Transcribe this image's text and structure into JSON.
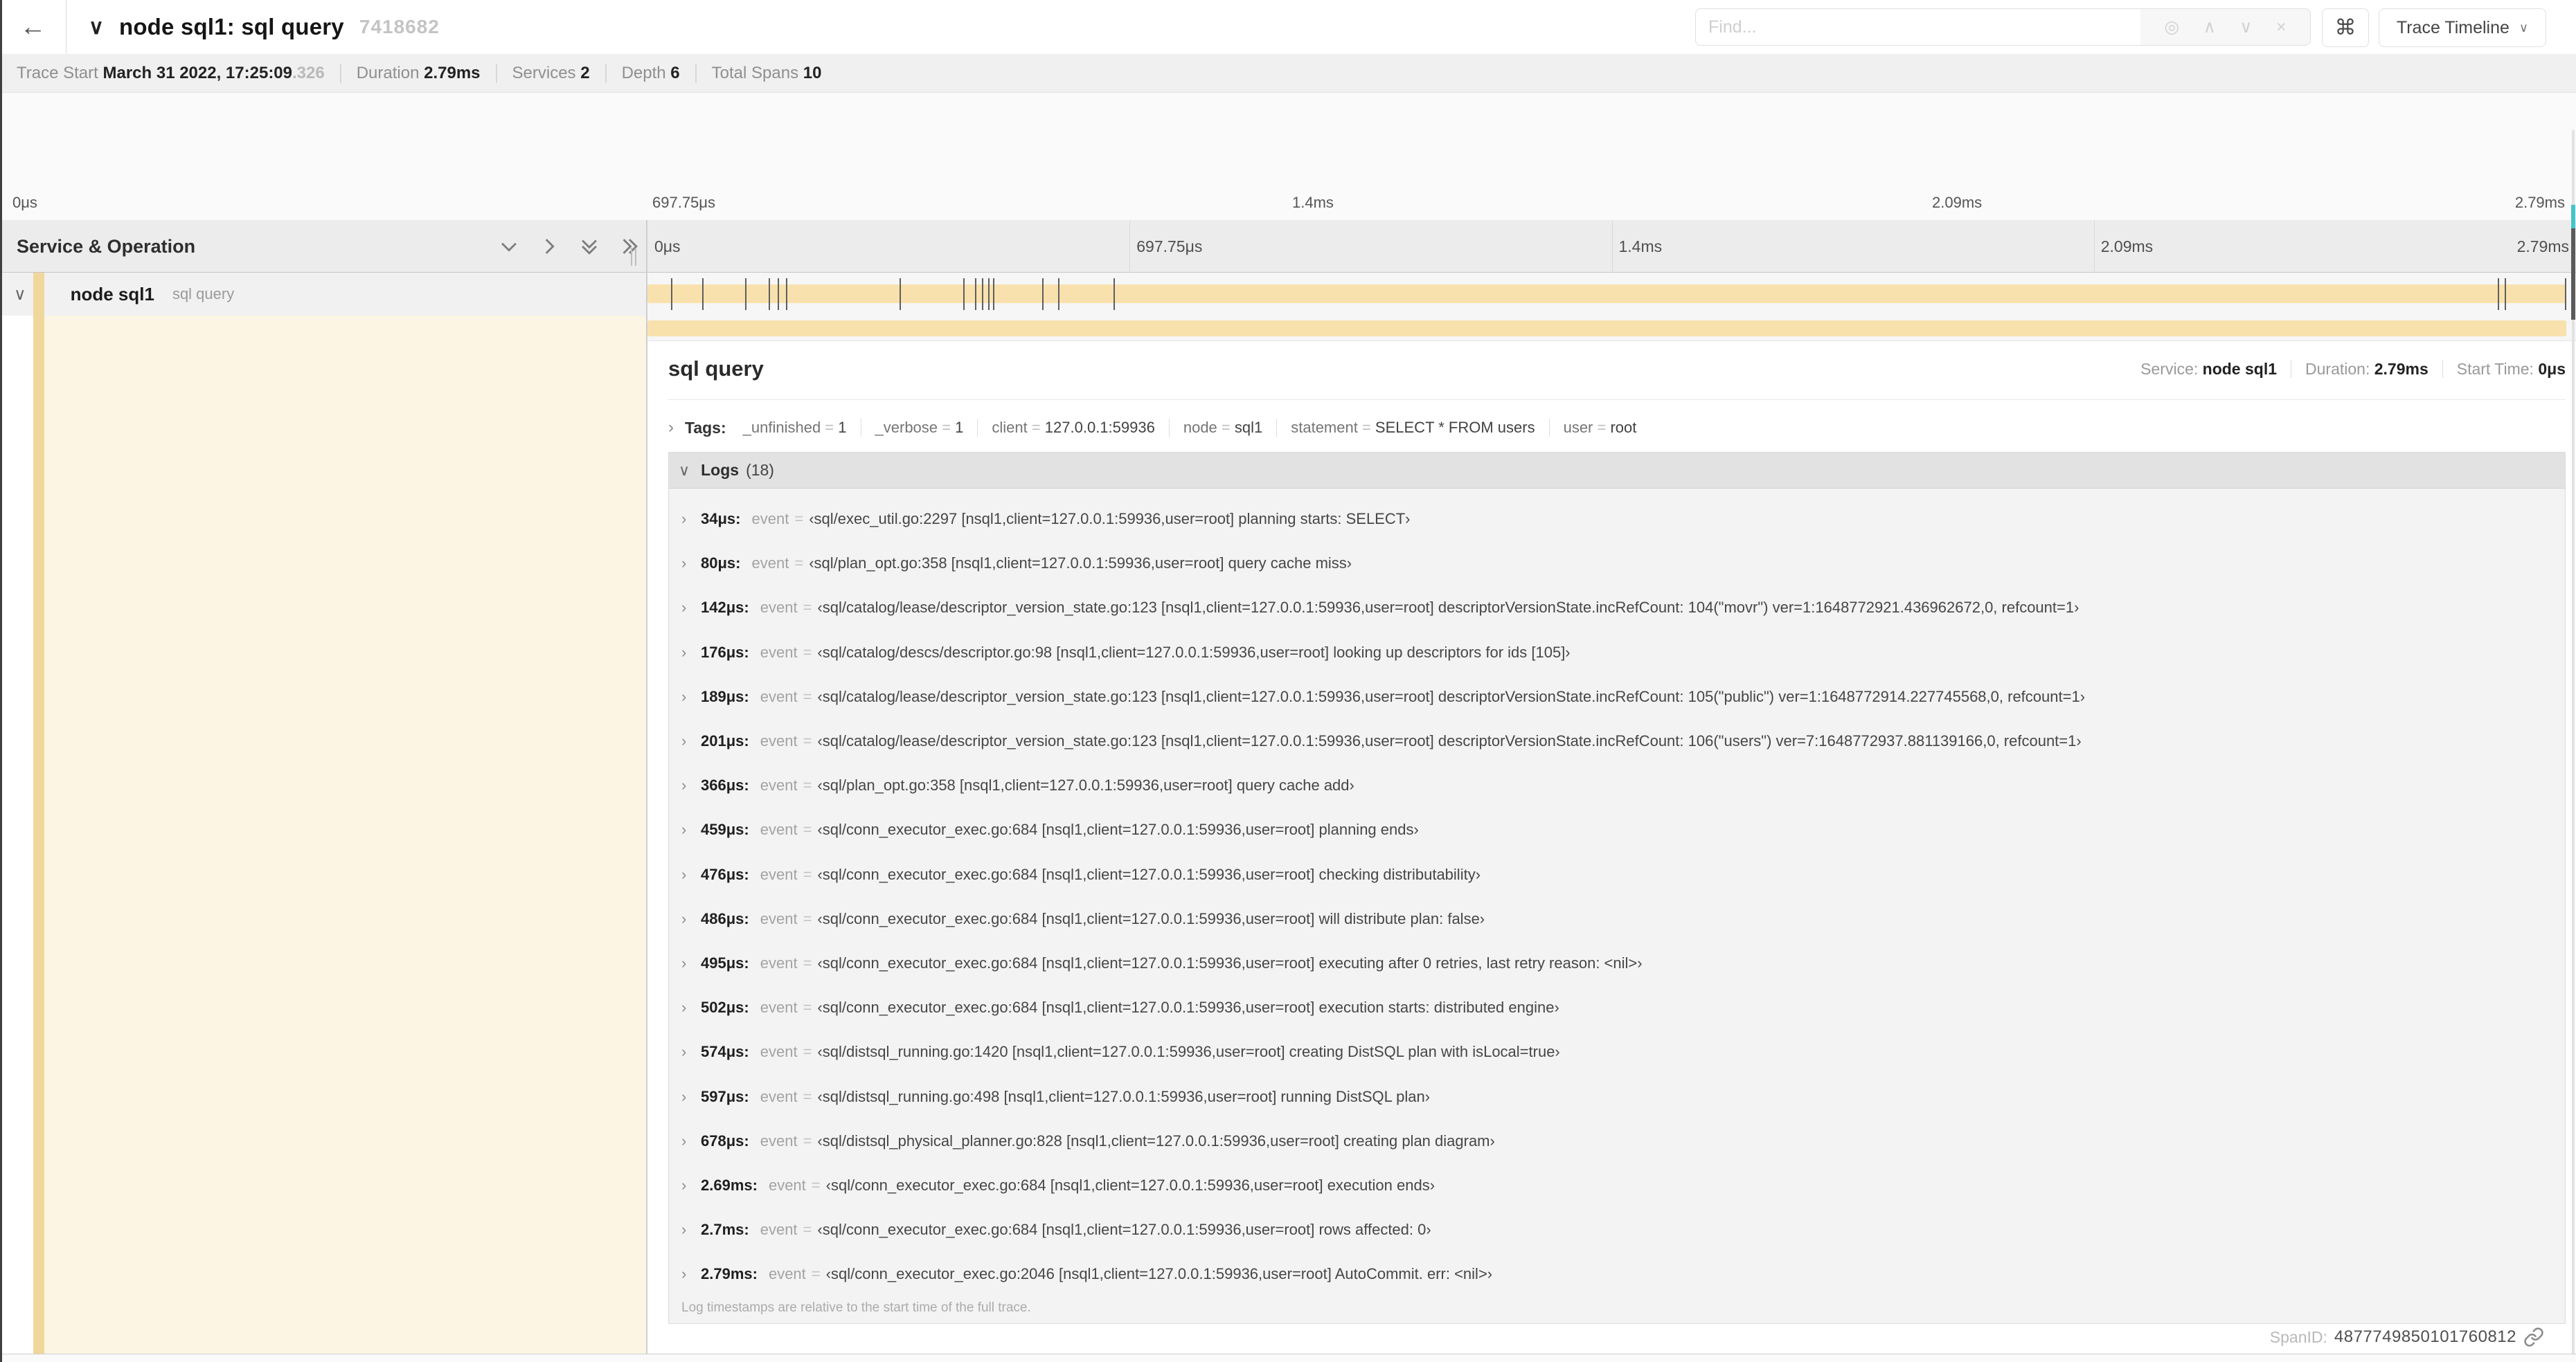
{
  "header": {
    "back_icon": "←",
    "title_chevron": "∨",
    "title": "node sql1: sql query",
    "trace_id": "7418682",
    "find_placeholder": "Find...",
    "locate_icon": "◎",
    "prev_icon": "∧",
    "next_icon": "∨",
    "clear_icon": "×",
    "cmd_icon": "⌘",
    "view_selector": "Trace Timeline",
    "view_chevron": "∨"
  },
  "trace_info": {
    "items": [
      {
        "label": "Trace Start ",
        "value": "March 31 2022, 17:25:09",
        "suffix": ".326"
      },
      {
        "label": "Duration ",
        "value": "2.79ms",
        "suffix": ""
      },
      {
        "label": "Services ",
        "value": "2",
        "suffix": ""
      },
      {
        "label": "Depth ",
        "value": "6",
        "suffix": ""
      },
      {
        "label": "Total Spans ",
        "value": "10",
        "suffix": ""
      }
    ]
  },
  "colors": {
    "tan": "#f8e1ac",
    "teal": "#45c5c9",
    "accent_strip": "#f0d79b",
    "detail_left_bg": "#fcf5e3"
  },
  "ticks": [
    "0μs",
    "697.75μs",
    "1.4ms",
    "2.09ms",
    "2.79ms"
  ],
  "minimap": {
    "rows": [
      {
        "start": 0.0,
        "end": 1.0,
        "color": "tan"
      },
      {
        "start": 0.194,
        "end": 0.954,
        "color": "tan"
      },
      {
        "start": 0.276,
        "end": 0.931,
        "color": "tan"
      },
      {
        "start": 0.31,
        "end": 0.884,
        "color": "tan"
      },
      {
        "start": 0.372,
        "end": 0.739,
        "color": "teal"
      },
      {
        "start": 0.423,
        "end": 0.859,
        "color": "teal"
      },
      {
        "start": 0.228,
        "end": 0.951,
        "color": "tan"
      },
      {
        "start": 0.985,
        "end": 0.995,
        "color": "tan"
      }
    ]
  },
  "timeline": {
    "header": "Service & Operation",
    "row": {
      "expander": "∨",
      "service": "node sql1",
      "operation": "sql query"
    },
    "duration_us": 2790,
    "log_marks_us": [
      34,
      80,
      142,
      176,
      189,
      201,
      366,
      459,
      476,
      486,
      495,
      502,
      574,
      597,
      678,
      2690,
      2700,
      2790
    ]
  },
  "detail": {
    "title": "sql query",
    "meta": [
      {
        "label": "Service: ",
        "value": "node sql1"
      },
      {
        "label": "Duration: ",
        "value": "2.79ms"
      },
      {
        "label": "Start Time: ",
        "value": "0μs"
      }
    ],
    "tags": {
      "chevron": "›",
      "label": "Tags:",
      "eq": " = ",
      "items": [
        {
          "key": "_unfinished",
          "value": "1"
        },
        {
          "key": "_verbose",
          "value": "1"
        },
        {
          "key": "client",
          "value": "127.0.0.1:59936"
        },
        {
          "key": "node",
          "value": "sql1"
        },
        {
          "key": "statement",
          "value": "SELECT * FROM users"
        },
        {
          "key": "user",
          "value": "root"
        }
      ]
    },
    "logs": {
      "chevron": "∨",
      "label": "Logs",
      "count": "(18)",
      "row_chevron": "›",
      "key": "event",
      "eq": "=",
      "items": [
        {
          "t": "34μs:",
          "value": "‹sql/exec_util.go:2297 [nsql1,client=127.0.0.1:59936,user=root] planning starts: SELECT›"
        },
        {
          "t": "80μs:",
          "value": "‹sql/plan_opt.go:358 [nsql1,client=127.0.0.1:59936,user=root] query cache miss›"
        },
        {
          "t": "142μs:",
          "value": "‹sql/catalog/lease/descriptor_version_state.go:123 [nsql1,client=127.0.0.1:59936,user=root] descriptorVersionState.incRefCount: 104(\"movr\") ver=1:1648772921.436962672,0, refcount=1›"
        },
        {
          "t": "176μs:",
          "value": "‹sql/catalog/descs/descriptor.go:98 [nsql1,client=127.0.0.1:59936,user=root] looking up descriptors for ids [105]›"
        },
        {
          "t": "189μs:",
          "value": "‹sql/catalog/lease/descriptor_version_state.go:123 [nsql1,client=127.0.0.1:59936,user=root] descriptorVersionState.incRefCount: 105(\"public\") ver=1:1648772914.227745568,0, refcount=1›"
        },
        {
          "t": "201μs:",
          "value": "‹sql/catalog/lease/descriptor_version_state.go:123 [nsql1,client=127.0.0.1:59936,user=root] descriptorVersionState.incRefCount: 106(\"users\") ver=7:1648772937.881139166,0, refcount=1›"
        },
        {
          "t": "366μs:",
          "value": "‹sql/plan_opt.go:358 [nsql1,client=127.0.0.1:59936,user=root] query cache add›"
        },
        {
          "t": "459μs:",
          "value": "‹sql/conn_executor_exec.go:684 [nsql1,client=127.0.0.1:59936,user=root] planning ends›"
        },
        {
          "t": "476μs:",
          "value": "‹sql/conn_executor_exec.go:684 [nsql1,client=127.0.0.1:59936,user=root] checking distributability›"
        },
        {
          "t": "486μs:",
          "value": "‹sql/conn_executor_exec.go:684 [nsql1,client=127.0.0.1:59936,user=root] will distribute plan: false›"
        },
        {
          "t": "495μs:",
          "value": "‹sql/conn_executor_exec.go:684 [nsql1,client=127.0.0.1:59936,user=root] executing after 0 retries, last retry reason: <nil>›"
        },
        {
          "t": "502μs:",
          "value": "‹sql/conn_executor_exec.go:684 [nsql1,client=127.0.0.1:59936,user=root] execution starts: distributed engine›"
        },
        {
          "t": "574μs:",
          "value": "‹sql/distsql_running.go:1420 [nsql1,client=127.0.0.1:59936,user=root] creating DistSQL plan with isLocal=true›"
        },
        {
          "t": "597μs:",
          "value": "‹sql/distsql_running.go:498 [nsql1,client=127.0.0.1:59936,user=root] running DistSQL plan›"
        },
        {
          "t": "678μs:",
          "value": "‹sql/distsql_physical_planner.go:828 [nsql1,client=127.0.0.1:59936,user=root] creating plan diagram›"
        },
        {
          "t": "2.69ms:",
          "value": "‹sql/conn_executor_exec.go:684 [nsql1,client=127.0.0.1:59936,user=root] execution ends›"
        },
        {
          "t": "2.7ms:",
          "value": "‹sql/conn_executor_exec.go:684 [nsql1,client=127.0.0.1:59936,user=root] rows affected: 0›"
        },
        {
          "t": "2.79ms:",
          "value": "‹sql/conn_executor_exec.go:2046 [nsql1,client=127.0.0.1:59936,user=root] AutoCommit. err: <nil>›"
        }
      ],
      "note": "Log timestamps are relative to the start time of the full trace."
    },
    "footer": {
      "label": "SpanID:",
      "value": "4877749850101760812"
    }
  }
}
